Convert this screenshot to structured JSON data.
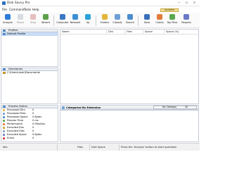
{
  "window": {
    "title": "Disk Savvy Pro",
    "controls": [
      "—",
      "☐",
      "✕"
    ]
  },
  "menu": [
    "File",
    "Command",
    "Tools",
    "Help"
  ],
  "updates_label": "Updates",
  "toolbar": [
    {
      "label": "Analyze",
      "enabled": true,
      "color": "#2f7bd8"
    },
    {
      "label": "Pause",
      "enabled": false,
      "color": "#b9c3cf"
    },
    {
      "label": "Stop",
      "enabled": false,
      "color": "#d68a8a"
    },
    {
      "label": "Wizard",
      "enabled": true,
      "color": "#5da04a"
    },
    {
      "label": "Computer",
      "enabled": true,
      "color": "#3b78c4"
    },
    {
      "label": "Network",
      "enabled": true,
      "color": "#3c8fd3"
    },
    {
      "label": "Up",
      "enabled": true,
      "color": "#2ca2d8"
    },
    {
      "label": "Folders",
      "enabled": true,
      "color": "#e2b63a"
    },
    {
      "label": "Classify",
      "enabled": true,
      "color": "#6e9fd6"
    },
    {
      "label": "Search",
      "enabled": true,
      "color": "#4a8ccf"
    },
    {
      "label": "Save",
      "enabled": true,
      "color": "#3a6fba"
    },
    {
      "label": "Charts",
      "enabled": true,
      "color": "#e07b39"
    },
    {
      "label": "Top Files",
      "enabled": true,
      "color": "#5aa74f"
    },
    {
      "label": "Reports",
      "enabled": true,
      "color": "#6a78c9"
    }
  ],
  "profiles": {
    "header": "Profiles",
    "items": [
      {
        "label": "Default Profile",
        "selected": true
      }
    ]
  },
  "directories": {
    "header": "Directories",
    "items": [
      "C:\\Users\\user\\Documents"
    ]
  },
  "process_status": {
    "header": "Process Status",
    "rows": [
      {
        "key": "Processed Dirs",
        "value": "0",
        "color": "#e2b63a"
      },
      {
        "key": "Processed Files",
        "value": "0",
        "color": "#6e9fd6"
      },
      {
        "key": "Processed Space",
        "value": "0 Bytes",
        "color": "#4a8ccf"
      },
      {
        "key": "Process Time",
        "value": "0 ms",
        "color": "#5aa74f"
      },
      {
        "key": "Performance",
        "value": "0 Files/Sec",
        "color": "#e07b39"
      },
      {
        "key": "Excluded Dirs",
        "value": "0",
        "color": "#d0a030"
      },
      {
        "key": "Excluded Files",
        "value": "0",
        "color": "#8aa0c0"
      },
      {
        "key": "Excluded Space",
        "value": "0 Bytes",
        "color": "#6a78c9"
      },
      {
        "key": "Errors",
        "value": "0",
        "color": "#d04040"
      }
    ]
  },
  "columns": [
    "Name",
    "Dirs",
    "Files",
    "Space",
    "Space (%)"
  ],
  "category_bar": {
    "label": "Categorize By Extension",
    "filter": "No Categorize",
    "value": "20"
  },
  "statusbar": {
    "state": "Idle",
    "files": "Files",
    "space": "Disk Space",
    "message": "Press the 'Analyze' button to start operation"
  }
}
